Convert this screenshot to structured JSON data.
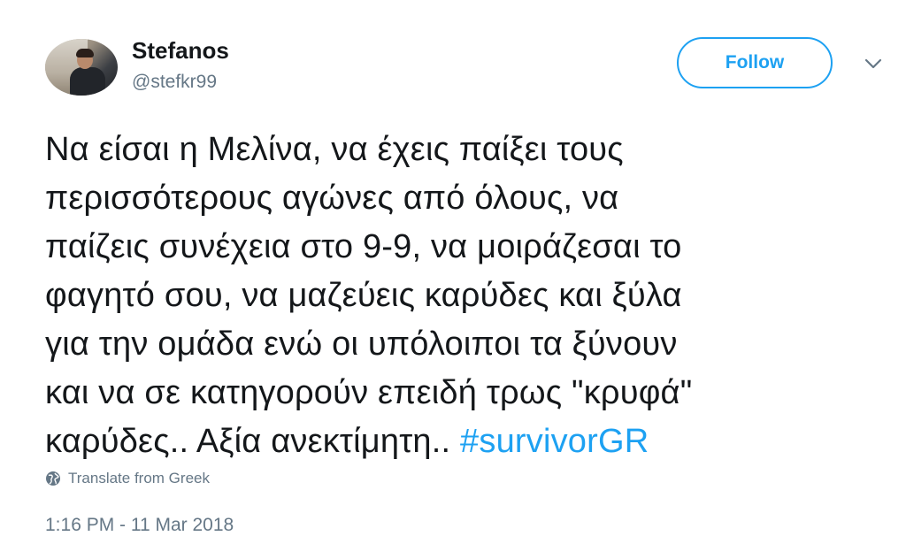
{
  "user": {
    "name": "Stefanos",
    "handle": "@stefkr99"
  },
  "follow_button": {
    "label": "Follow"
  },
  "tweet": {
    "lines": [
      "Να είσαι η Μελίνα, να έχεις παίξει τους",
      "περισσότερους αγώνες από όλους, να",
      "παίζεις συνέχεια στο 9-9, να μοιράζεσαι το",
      "φαγητό σου, να μαζεύεις καρύδες και ξύλα",
      "για την ομάδα ενώ οι υπόλοιποι τα ξύνουν",
      "και να σε κατηγορούν επειδή τρως \"κρυφά\""
    ],
    "last_line_text": "καρύδες.. Αξία ανεκτίμητη.. ",
    "hashtag": "#survivorGR"
  },
  "translate": {
    "label": "Translate from Greek",
    "icon": "globe-icon"
  },
  "timestamp": "1:16 PM - 11 Mar 2018",
  "colors": {
    "accent": "#1da1f2",
    "text": "#14171a",
    "muted": "#657786"
  }
}
